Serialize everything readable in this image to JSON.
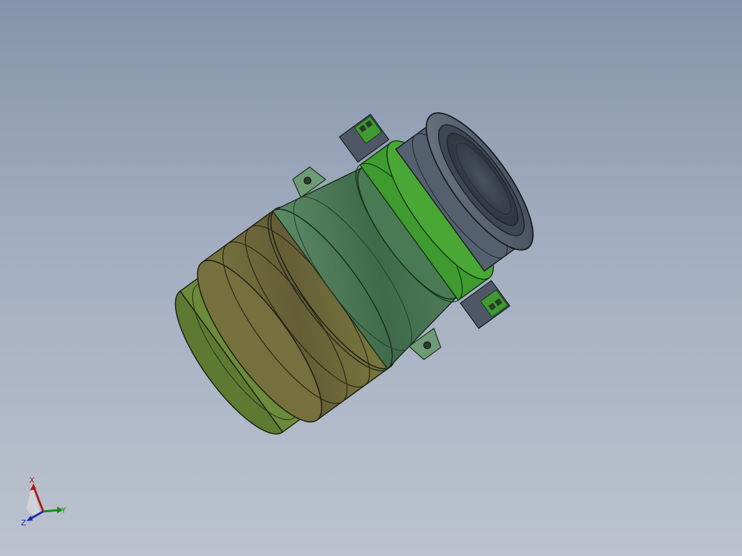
{
  "viewport": {
    "background_top": "#8594ac",
    "background_bottom": "#bcc3cf"
  },
  "model": {
    "icon": "lens-assembly-model",
    "colors": {
      "lens_cap": "#5b6573",
      "lens_cap_dark": "#3c4450",
      "bracket_green": "#3f9a2f",
      "body_green": "#4f7a58",
      "body_green_dark": "#3e6547",
      "barrel_tan": "#6f6a3e",
      "barrel_olive": "#5f7a35",
      "mount_gray": "#4a5260"
    }
  },
  "triad": {
    "x_label": "X",
    "y_label": "Y",
    "z_label": "Z",
    "x_color": "#b01818",
    "y_color": "#1a8a1a",
    "z_color": "#1a2ab0"
  }
}
